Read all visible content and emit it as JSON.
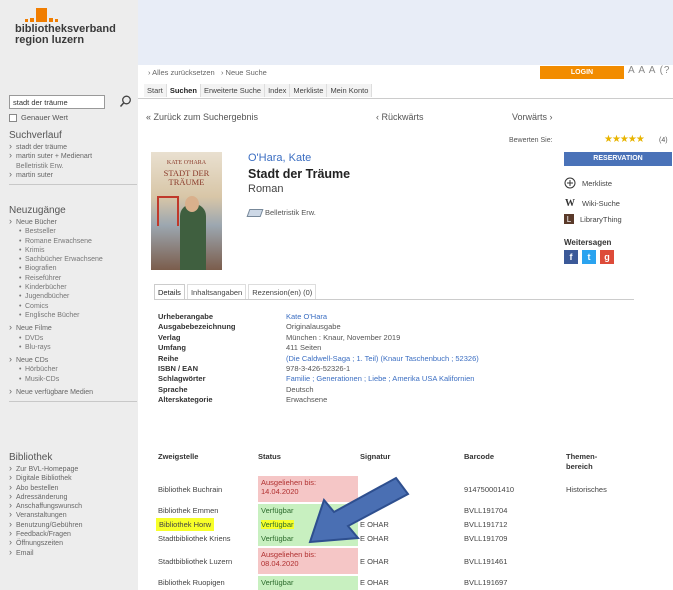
{
  "logo": {
    "line1": "bibliotheksverband",
    "line2": "region luzern",
    "colors": {
      "blocks": "#f07d00"
    }
  },
  "search": {
    "value": "stadt der träume",
    "icon": "search-icon",
    "exact_label": "Genauer Wert"
  },
  "sidebar": {
    "history_title": "Suchverlauf",
    "history": [
      "stadt der träume",
      "martin suter + Medienart",
      "Belletristik Erw.",
      "martin suter"
    ],
    "new_title": "Neuzugänge",
    "new_books": "Neue Bücher",
    "new_books_items": [
      "Bestseller",
      "Romane Erwachsene",
      "Krimis",
      "Sachbücher Erwachsene",
      "Biografien",
      "Reiseführer",
      "Kinderbücher",
      "Jugendbücher",
      "Comics",
      "Englische Bücher"
    ],
    "new_films": "Neue Filme",
    "new_films_items": [
      "DVDs",
      "Blu-rays"
    ],
    "new_cds": "Neue CDs",
    "new_cds_items": [
      "Hörbücher",
      "Musik-CDs"
    ],
    "all_new": "Neue verfügbare Medien",
    "library_title": "Bibliothek",
    "library_items": [
      "Zur BVL-Homepage",
      "Digitale Bibliothek",
      "Abo bestellen",
      "Adressänderung",
      "Anschaffungswunsch",
      "Veranstaltungen",
      "Benutzung/Gebühren",
      "Feedback/Fragen",
      "Öffnungszeiten",
      "Email"
    ]
  },
  "topnav": {
    "crumb1": "› Alles zurücksetzen",
    "crumb2": "› Neue Suche",
    "login": "LOGIN",
    "font_sizes": "A A A (?"
  },
  "tabs": [
    "Start",
    "Suchen",
    "Erweiterte Suche",
    "Index",
    "Merkliste",
    "Mein Konto"
  ],
  "nav": {
    "back": "« Zurück zum Suchergebnis",
    "prev": "‹ Rückwärts",
    "next": "Vorwärts ›"
  },
  "rating": {
    "label": "Bewerten Sie:",
    "count": "(4)",
    "stars": "★★★★★"
  },
  "book": {
    "author": "O'Hara, Kate",
    "title": "Stadt der Träume",
    "genre": "Roman",
    "media": "Belletristik Erw.",
    "cover_author": "KATE O'HARA",
    "cover_title": "STADT DER TRÄUME"
  },
  "actions": {
    "reserve": "RESERVATION",
    "merkliste": "Merkliste",
    "wiki": "Wiki-Suche",
    "librarything": "LibraryThing",
    "share": "Weitersagen"
  },
  "detail_tabs": [
    "Details",
    "Inhaltsangaben",
    "Rezension(en) (0)"
  ],
  "meta": [
    {
      "k": "Urheberangabe",
      "v": "Kate O'Hara",
      "link": true
    },
    {
      "k": "Ausgabebezeichnung",
      "v": "Originalausgabe",
      "link": false
    },
    {
      "k": "Verlag",
      "v": "München : Knaur, November 2019",
      "link": false
    },
    {
      "k": "Umfang",
      "v": "411 Seiten",
      "link": false
    },
    {
      "k": "Reihe",
      "v": "(Die Caldwell-Saga ; 1. Teil) (Knaur Taschenbuch ; 52326)",
      "link": true
    },
    {
      "k": "ISBN / EAN",
      "v": "978-3-426-52326-1",
      "link": false
    },
    {
      "k": "Schlagwörter",
      "v": "Familie ; Generationen ; Liebe ; Amerika USA Kalifornien",
      "link": true
    },
    {
      "k": "Sprache",
      "v": "Deutsch",
      "link": false
    },
    {
      "k": "Alterskategorie",
      "v": "Erwachsene",
      "link": false
    }
  ],
  "table": {
    "headers": {
      "branch": "Zweigstelle",
      "status": "Status",
      "signature": "Signatur",
      "barcode": "Barcode",
      "theme1": "Themen-",
      "theme2": "bereich"
    },
    "rows": [
      {
        "branch": "Bibliothek Buchrain",
        "status1": "Ausgeliehen bis:",
        "status2": "14.04.2020",
        "sig": "",
        "barcode": "914750001410",
        "theme": "Historisches"
      },
      {
        "branch": "Bibliothek Emmen",
        "status1": "Verfügbar",
        "status2": "",
        "sig": "",
        "barcode": "BVLL191704",
        "theme": ""
      },
      {
        "branch": "Bibliothek Horw",
        "status1": "Verfügbar",
        "status2": "",
        "sig": "E OHAR",
        "barcode": "BVLL191712",
        "theme": ""
      },
      {
        "branch": "Stadtbibliothek Kriens",
        "status1": "Verfügbar",
        "status2": "",
        "sig": "E OHAR",
        "barcode": "BVLL191709",
        "theme": ""
      },
      {
        "branch": "Stadtbibliothek Luzern",
        "status1": "Ausgeliehen bis:",
        "status2": "08.04.2020",
        "sig": "E OHAR",
        "barcode": "BVLL191461",
        "theme": ""
      },
      {
        "branch": "Bibliothek Ruopigen",
        "status1": "Verfügbar",
        "status2": "",
        "sig": "E OHAR",
        "barcode": "BVLL191697",
        "theme": ""
      }
    ]
  },
  "colors": {
    "accent": "#f28c00",
    "reserve": "#4a72b8",
    "available": "#c8f0c0",
    "unavailable": "#f5c6c6",
    "highlight": "#f7ff29",
    "arrow": "#4a6fb3"
  }
}
